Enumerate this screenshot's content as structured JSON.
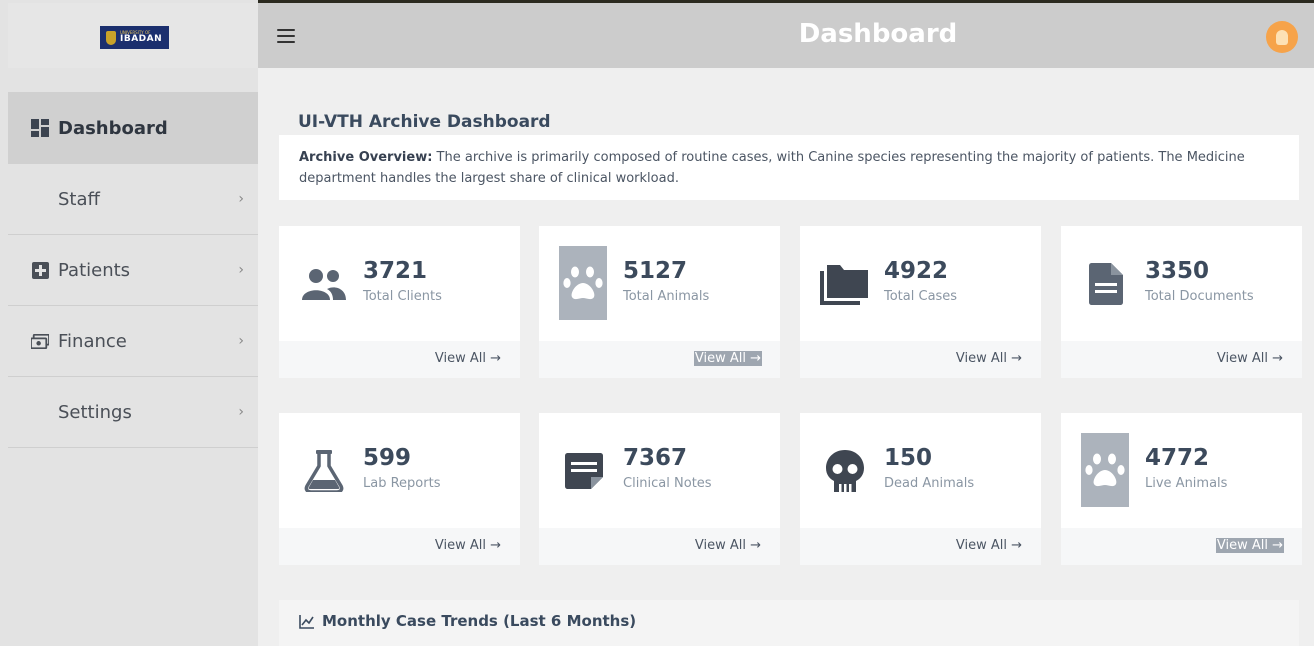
{
  "sidebar": {
    "logo": {
      "line1": "UNIVERSITY OF",
      "line2": "IBADAN"
    },
    "items": [
      {
        "label": "Dashboard",
        "icon": "dashboard-icon"
      },
      {
        "label": "Staff",
        "icon": ""
      },
      {
        "label": "Patients",
        "icon": "plus-square-icon"
      },
      {
        "label": "Finance",
        "icon": "money-icon"
      },
      {
        "label": "Settings",
        "icon": ""
      }
    ]
  },
  "topbar": {
    "title": "Dashboard"
  },
  "main": {
    "section_title": "UI-VTH Archive Dashboard",
    "overview": {
      "lead": "Archive Overview:",
      "text": " The archive is primarily composed of routine cases, with Canine species representing the majority of patients. The Medicine department handles the largest share of clinical workload."
    },
    "cards": [
      {
        "value": "3721",
        "label": "Total Clients",
        "link": "View All →",
        "icon": "users-icon"
      },
      {
        "value": "5127",
        "label": "Total Animals",
        "link": "View All →",
        "icon": "paw-icon"
      },
      {
        "value": "4922",
        "label": "Total Cases",
        "link": "View All →",
        "icon": "folders-icon"
      },
      {
        "value": "3350",
        "label": "Total Documents",
        "link": "View All →",
        "icon": "document-icon"
      },
      {
        "value": "599",
        "label": "Lab Reports",
        "link": "View All →",
        "icon": "flask-icon"
      },
      {
        "value": "7367",
        "label": "Clinical Notes",
        "link": "View All →",
        "icon": "note-icon"
      },
      {
        "value": "150",
        "label": "Dead Animals",
        "link": "View All →",
        "icon": "skull-icon"
      },
      {
        "value": "4772",
        "label": "Live Animals",
        "link": "View All →",
        "icon": "paw-icon"
      }
    ],
    "trends_title": "Monthly Case Trends (Last 6 Months)"
  },
  "colors": {
    "accent": "#3c4a5c",
    "sidebar_active": "#d0d0d0",
    "topbar": "#cccccc",
    "bulb": "#f6a34a"
  }
}
